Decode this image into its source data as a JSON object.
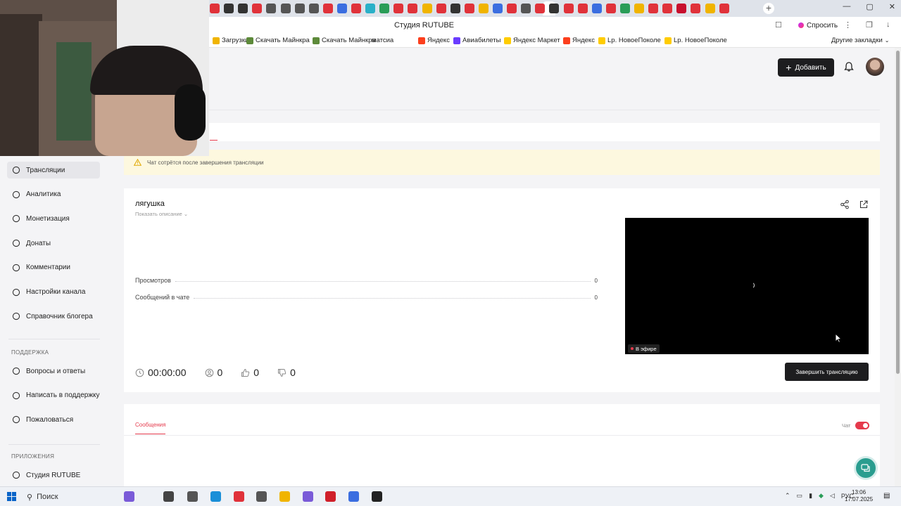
{
  "browser": {
    "title": "Студия RUTUBE",
    "ask_label": "Спросить",
    "other_bookmarks": "Другие закладки",
    "bookmarks": [
      {
        "label": "Загрузки",
        "color": "#f0b400"
      },
      {
        "label": "Скачать Майнкра",
        "color": "#5d8a3a"
      },
      {
        "label": "Скачать Майнкра",
        "color": "#5d8a3a"
      },
      {
        "label": "матсиа",
        "color": ""
      },
      {
        "label": "Яндекс",
        "color": "#fc3f1d"
      },
      {
        "label": "Авиабилеты",
        "color": "#6a3cff"
      },
      {
        "label": "Яндекс Маркет",
        "color": "#ffcc00"
      },
      {
        "label": "Яндекс",
        "color": "#fc3f1d"
      },
      {
        "label": "Lp. НовоеПоколе",
        "color": "#ffcc00"
      },
      {
        "label": "Lp. НовоеПоколе",
        "color": "#ffcc00"
      }
    ]
  },
  "header": {
    "add_label": "Добавить"
  },
  "sidebar": {
    "items": [
      {
        "label": "Трансляции",
        "icon": "broadcast-icon",
        "active": true
      },
      {
        "label": "Аналитика",
        "icon": "analytics-icon"
      },
      {
        "label": "Монетизация",
        "icon": "monetization-icon"
      },
      {
        "label": "Донаты",
        "icon": "donations-icon"
      },
      {
        "label": "Комментарии",
        "icon": "comments-icon"
      },
      {
        "label": "Настройки канала",
        "icon": "settings-icon"
      },
      {
        "label": "Справочник блогера",
        "icon": "guide-icon"
      }
    ],
    "support_title": "ПОДДЕРЖКА",
    "support_items": [
      {
        "label": "Вопросы и ответы",
        "icon": "faq-icon"
      },
      {
        "label": "Написать в поддержку",
        "icon": "mail-icon"
      },
      {
        "label": "Пожаловаться",
        "icon": "flag-icon"
      }
    ],
    "apps_title": "ПРИЛОЖЕНИЯ",
    "apps_items": [
      {
        "label": "Студия RUTUBE",
        "icon": "studio-icon"
      }
    ]
  },
  "warning": {
    "text": "Чат сотрётся после завершения трансляции"
  },
  "stream": {
    "title": "лягушка",
    "show_description": "Показать описание",
    "stats": [
      {
        "label": "Просмотров",
        "value": "0"
      },
      {
        "label": "Сообщений в чате",
        "value": "0"
      }
    ],
    "live_label": "В эфире",
    "timer": "00:00:00",
    "viewers": "0",
    "likes": "0",
    "dislikes": "0",
    "end_label": "Завершить трансляцию"
  },
  "chat": {
    "tab_label": "Сообщения",
    "toggle_label": "Чат",
    "toggle_on": true
  },
  "taskbar": {
    "search_label": "Поиск",
    "lang": "РУС",
    "time": "13:06",
    "date": "17.07.2025"
  },
  "colors": {
    "accent": "#e53a4c",
    "button_dark": "#1d1d1f",
    "warning_bg": "#fdf8df",
    "help_fab": "#2a9d8f"
  }
}
